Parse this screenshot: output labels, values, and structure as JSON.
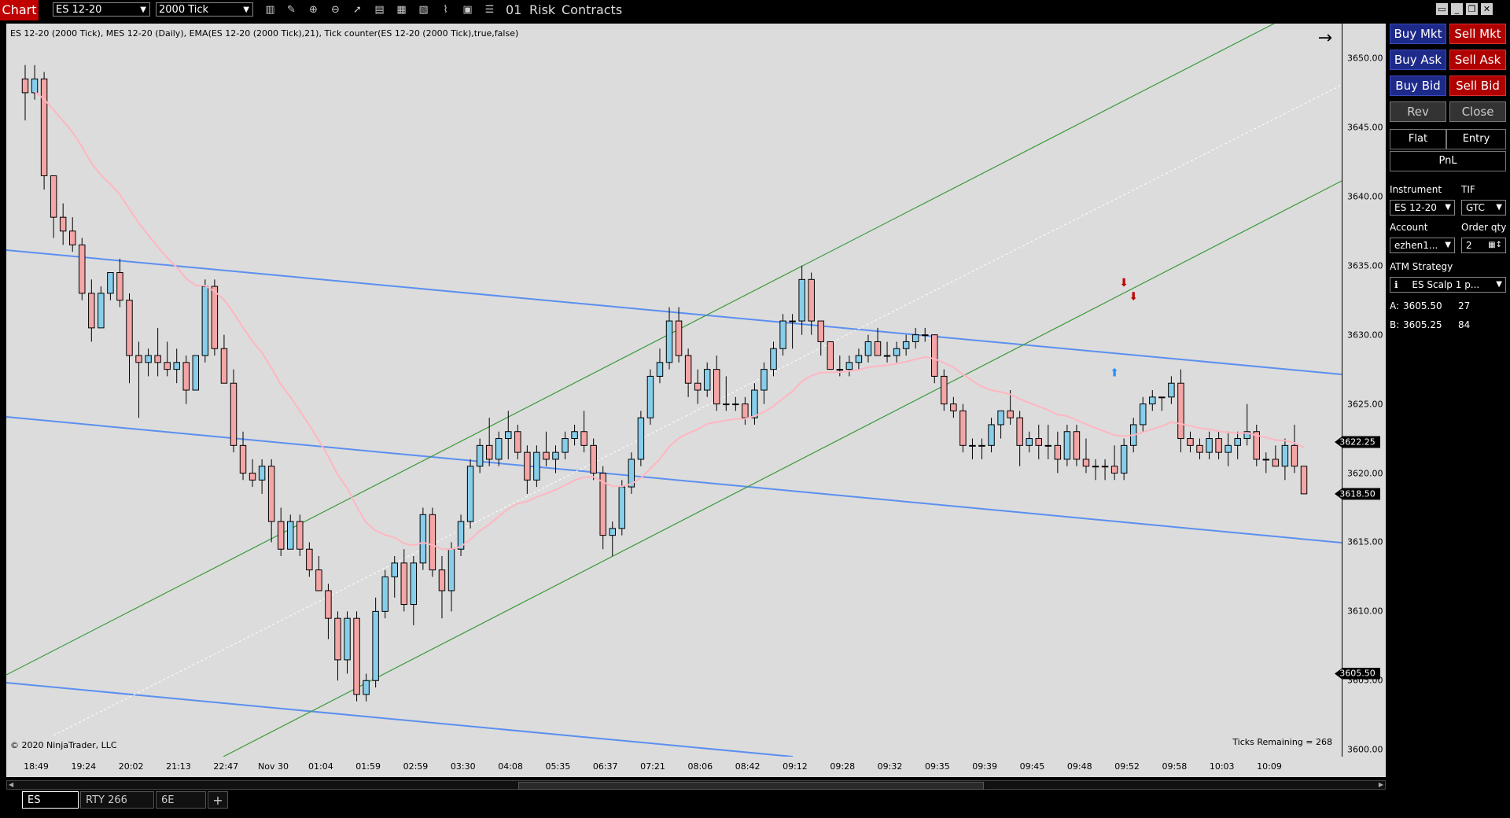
{
  "toolbar": {
    "chart_tab": "Chart",
    "instrument": "ES 12-20",
    "interval": "2000 Tick",
    "risk_label": "Risk",
    "count_label": "01",
    "contracts_label": "Contracts"
  },
  "chart": {
    "title": "ES 12-20 (2000 Tick), MES 12-20 (Daily), EMA(ES 12-20 (2000 Tick),21), Tick counter(ES 12-20 (2000 Tick),true,false)",
    "copyright": "© 2020 NinjaTrader, LLC",
    "ticks_remaining": "Ticks Remaining = 268",
    "nav_arrow": "→"
  },
  "chart_data": {
    "type": "candlestick",
    "y_ticks": [
      "3650.00",
      "3645.00",
      "3640.00",
      "3635.00",
      "3630.00",
      "3625.00",
      "3620.00",
      "3615.00",
      "3610.00",
      "3605.00",
      "3600.00"
    ],
    "x_ticks": [
      "18:49",
      "19:24",
      "20:02",
      "21:13",
      "22:47",
      "Nov 30",
      "01:04",
      "01:59",
      "02:59",
      "03:30",
      "04:08",
      "05:35",
      "06:37",
      "07:21",
      "08:06",
      "08:42",
      "09:12",
      "09:28",
      "09:32",
      "09:35",
      "09:39",
      "09:45",
      "09:48",
      "09:52",
      "09:58",
      "10:03",
      "10:09"
    ],
    "price_tags": [
      {
        "label": "3622.25",
        "value": 3622.25
      },
      {
        "label": "3618.50",
        "value": 3618.5
      },
      {
        "label": "3605.50",
        "value": 3605.5
      }
    ],
    "ylim": [
      3599.5,
      3652.5
    ],
    "candles": [
      [
        3648.5,
        3649.5,
        3645.5,
        3647.5
      ],
      [
        3647.5,
        3649.5,
        3647.0,
        3648.5
      ],
      [
        3648.5,
        3649.0,
        3640.5,
        3641.5
      ],
      [
        3641.5,
        3641.5,
        3637.0,
        3638.5
      ],
      [
        3638.5,
        3639.5,
        3636.5,
        3637.5
      ],
      [
        3637.5,
        3638.5,
        3636.0,
        3636.5
      ],
      [
        3636.5,
        3637.0,
        3632.5,
        3633.0
      ],
      [
        3633.0,
        3634.0,
        3629.5,
        3630.5
      ],
      [
        3630.5,
        3633.5,
        3630.5,
        3633.0
      ],
      [
        3633.0,
        3634.5,
        3632.5,
        3634.5
      ],
      [
        3634.5,
        3635.5,
        3632.0,
        3632.5
      ],
      [
        3632.5,
        3633.0,
        3626.5,
        3628.5
      ],
      [
        3628.5,
        3629.5,
        3624.0,
        3628.0
      ],
      [
        3628.0,
        3629.0,
        3627.0,
        3628.5
      ],
      [
        3628.5,
        3630.5,
        3627.0,
        3628.0
      ],
      [
        3628.0,
        3629.5,
        3627.0,
        3627.5
      ],
      [
        3627.5,
        3629.0,
        3626.5,
        3628.0
      ],
      [
        3628.0,
        3628.5,
        3625.0,
        3626.0
      ],
      [
        3626.0,
        3628.5,
        3626.0,
        3628.5
      ],
      [
        3628.5,
        3634.0,
        3628.0,
        3633.5
      ],
      [
        3633.5,
        3634.0,
        3628.5,
        3629.0
      ],
      [
        3629.0,
        3630.0,
        3626.5,
        3626.5
      ],
      [
        3626.5,
        3627.5,
        3621.5,
        3622.0
      ],
      [
        3622.0,
        3623.0,
        3619.5,
        3620.0
      ],
      [
        3620.0,
        3621.0,
        3619.0,
        3619.5
      ],
      [
        3619.5,
        3621.0,
        3618.5,
        3620.5
      ],
      [
        3620.5,
        3621.0,
        3615.0,
        3616.5
      ],
      [
        3616.5,
        3617.5,
        3614.0,
        3614.5
      ],
      [
        3614.5,
        3617.0,
        3614.5,
        3616.5
      ],
      [
        3616.5,
        3617.0,
        3614.0,
        3614.5
      ],
      [
        3614.5,
        3615.0,
        3612.5,
        3613.0
      ],
      [
        3613.0,
        3614.0,
        3611.5,
        3611.5
      ],
      [
        3611.5,
        3612.0,
        3608.0,
        3609.5
      ],
      [
        3609.5,
        3610.0,
        3605.0,
        3606.5
      ],
      [
        3606.5,
        3610.0,
        3605.5,
        3609.5
      ],
      [
        3609.5,
        3610.0,
        3603.5,
        3604.0
      ],
      [
        3604.0,
        3605.5,
        3603.5,
        3605.0
      ],
      [
        3605.0,
        3611.0,
        3604.5,
        3610.0
      ],
      [
        3610.0,
        3613.0,
        3609.5,
        3612.5
      ],
      [
        3612.5,
        3614.0,
        3611.0,
        3613.5
      ],
      [
        3613.5,
        3614.5,
        3610.0,
        3610.5
      ],
      [
        3610.5,
        3614.0,
        3609.0,
        3613.5
      ],
      [
        3613.5,
        3617.5,
        3613.0,
        3617.0
      ],
      [
        3617.0,
        3617.5,
        3612.5,
        3613.0
      ],
      [
        3613.0,
        3614.0,
        3609.5,
        3611.5
      ],
      [
        3611.5,
        3615.0,
        3610.0,
        3614.5
      ],
      [
        3614.5,
        3617.0,
        3614.0,
        3616.5
      ],
      [
        3616.5,
        3621.0,
        3616.0,
        3620.5
      ],
      [
        3620.5,
        3622.5,
        3620.0,
        3622.0
      ],
      [
        3622.0,
        3624.0,
        3620.5,
        3621.0
      ],
      [
        3621.0,
        3623.0,
        3620.5,
        3622.5
      ],
      [
        3622.5,
        3624.5,
        3621.0,
        3623.0
      ],
      [
        3623.0,
        3623.5,
        3621.0,
        3621.5
      ],
      [
        3621.5,
        3622.0,
        3618.5,
        3619.5
      ],
      [
        3619.5,
        3622.0,
        3619.0,
        3621.5
      ],
      [
        3621.5,
        3623.0,
        3620.5,
        3621.0
      ],
      [
        3621.0,
        3622.0,
        3620.0,
        3621.5
      ],
      [
        3621.5,
        3623.0,
        3621.0,
        3622.5
      ],
      [
        3622.5,
        3623.5,
        3622.0,
        3623.0
      ],
      [
        3623.0,
        3624.5,
        3621.5,
        3622.0
      ],
      [
        3622.0,
        3622.5,
        3619.5,
        3620.0
      ],
      [
        3620.0,
        3620.5,
        3614.5,
        3615.5
      ],
      [
        3615.5,
        3616.5,
        3614.0,
        3616.0
      ],
      [
        3616.0,
        3619.5,
        3615.5,
        3619.0
      ],
      [
        3619.0,
        3621.5,
        3618.5,
        3621.0
      ],
      [
        3621.0,
        3624.5,
        3620.5,
        3624.0
      ],
      [
        3624.0,
        3627.5,
        3623.5,
        3627.0
      ],
      [
        3627.0,
        3629.0,
        3626.5,
        3628.0
      ],
      [
        3628.0,
        3632.0,
        3627.5,
        3631.0
      ],
      [
        3631.0,
        3632.0,
        3628.0,
        3628.5
      ],
      [
        3628.5,
        3629.0,
        3625.5,
        3626.5
      ],
      [
        3626.5,
        3627.5,
        3625.0,
        3626.0
      ],
      [
        3626.0,
        3628.0,
        3625.5,
        3627.5
      ],
      [
        3627.5,
        3628.5,
        3624.5,
        3625.0
      ],
      [
        3625.0,
        3627.0,
        3624.5,
        3625.0
      ],
      [
        3625.0,
        3625.5,
        3624.5,
        3625.0
      ],
      [
        3625.0,
        3625.5,
        3623.5,
        3624.0
      ],
      [
        3624.0,
        3626.5,
        3623.5,
        3626.0
      ],
      [
        3626.0,
        3628.0,
        3625.0,
        3627.5
      ],
      [
        3627.5,
        3629.5,
        3627.0,
        3629.0
      ],
      [
        3629.0,
        3631.5,
        3628.5,
        3631.0
      ],
      [
        3631.0,
        3631.5,
        3629.0,
        3631.0
      ],
      [
        3631.0,
        3635.0,
        3630.0,
        3634.0
      ],
      [
        3634.0,
        3634.5,
        3630.0,
        3631.0
      ],
      [
        3631.0,
        3631.0,
        3628.5,
        3629.5
      ],
      [
        3629.5,
        3629.5,
        3627.5,
        3627.5
      ],
      [
        3627.5,
        3628.5,
        3627.0,
        3627.5
      ],
      [
        3627.5,
        3628.5,
        3627.0,
        3628.0
      ],
      [
        3628.0,
        3629.0,
        3627.5,
        3628.5
      ],
      [
        3628.5,
        3630.0,
        3628.0,
        3629.5
      ],
      [
        3629.5,
        3630.5,
        3628.5,
        3628.5
      ],
      [
        3628.5,
        3629.5,
        3628.0,
        3628.5
      ],
      [
        3628.5,
        3629.5,
        3628.0,
        3629.0
      ],
      [
        3629.0,
        3630.0,
        3628.5,
        3629.5
      ],
      [
        3629.5,
        3630.5,
        3629.0,
        3630.0
      ],
      [
        3630.0,
        3630.5,
        3629.5,
        3630.0
      ],
      [
        3630.0,
        3630.0,
        3626.5,
        3627.0
      ],
      [
        3627.0,
        3627.5,
        3624.5,
        3625.0
      ],
      [
        3625.0,
        3625.5,
        3624.0,
        3624.5
      ],
      [
        3624.5,
        3625.0,
        3621.5,
        3622.0
      ],
      [
        3622.0,
        3622.5,
        3621.0,
        3622.0
      ],
      [
        3622.0,
        3622.5,
        3621.0,
        3622.0
      ],
      [
        3622.0,
        3624.0,
        3621.5,
        3623.5
      ],
      [
        3623.5,
        3624.5,
        3622.5,
        3624.5
      ],
      [
        3624.5,
        3626.0,
        3623.5,
        3624.0
      ],
      [
        3624.0,
        3624.5,
        3620.5,
        3622.0
      ],
      [
        3622.0,
        3623.0,
        3621.5,
        3622.5
      ],
      [
        3622.5,
        3623.5,
        3621.0,
        3622.0
      ],
      [
        3622.0,
        3623.5,
        3621.0,
        3622.0
      ],
      [
        3622.0,
        3623.0,
        3620.0,
        3621.0
      ],
      [
        3621.0,
        3623.5,
        3620.5,
        3623.0
      ],
      [
        3623.0,
        3623.5,
        3620.5,
        3621.0
      ],
      [
        3621.0,
        3622.5,
        3620.0,
        3620.5
      ],
      [
        3620.5,
        3621.0,
        3619.5,
        3620.5
      ],
      [
        3620.5,
        3621.0,
        3619.5,
        3620.5
      ],
      [
        3620.5,
        3622.0,
        3619.5,
        3620.0
      ],
      [
        3620.0,
        3622.5,
        3619.5,
        3622.0
      ],
      [
        3622.0,
        3624.0,
        3621.5,
        3623.5
      ],
      [
        3623.5,
        3625.5,
        3623.0,
        3625.0
      ],
      [
        3625.0,
        3626.0,
        3624.5,
        3625.5
      ],
      [
        3625.5,
        3625.5,
        3624.5,
        3625.5
      ],
      [
        3625.5,
        3627.0,
        3625.0,
        3626.5
      ],
      [
        3626.5,
        3627.5,
        3621.5,
        3622.5
      ],
      [
        3622.5,
        3623.0,
        3621.5,
        3622.0
      ],
      [
        3622.0,
        3622.5,
        3621.0,
        3621.5
      ],
      [
        3621.5,
        3623.0,
        3621.0,
        3622.5
      ],
      [
        3622.5,
        3623.0,
        3621.0,
        3621.5
      ],
      [
        3621.5,
        3623.0,
        3620.5,
        3622.0
      ],
      [
        3622.0,
        3623.0,
        3621.0,
        3622.5
      ],
      [
        3622.5,
        3625.0,
        3622.0,
        3623.0
      ],
      [
        3623.0,
        3623.5,
        3620.5,
        3621.0
      ],
      [
        3621.0,
        3621.5,
        3620.0,
        3621.0
      ],
      [
        3621.0,
        3622.0,
        3620.5,
        3620.5
      ],
      [
        3620.5,
        3622.5,
        3619.5,
        3622.0
      ],
      [
        3622.0,
        3623.5,
        3620.0,
        3620.5
      ],
      [
        3620.5,
        3620.5,
        3618.5,
        3618.5
      ]
    ]
  },
  "trade_panel": {
    "buy_mkt": "Buy Mkt",
    "sell_mkt": "Sell Mkt",
    "buy_ask": "Buy Ask",
    "sell_ask": "Sell Ask",
    "buy_bid": "Buy Bid",
    "sell_bid": "Sell Bid",
    "rev": "Rev",
    "close": "Close",
    "flat": "Flat",
    "entry": "Entry",
    "pnl": "PnL",
    "instrument_label": "Instrument",
    "tif_label": "TIF",
    "instrument_value": "ES 12-20",
    "tif_value": "GTC",
    "account_label": "Account",
    "order_qty_label": "Order qty",
    "account_value": "ezhen1...",
    "order_qty_value": "2",
    "atm_label": "ATM Strategy",
    "atm_value": "ES Scalp 1 p...",
    "atm_info": "ℹ",
    "ask_label": "A:",
    "ask_price": "3605.50",
    "ask_size": "27",
    "bid_label": "B:",
    "bid_price": "3605.25",
    "bid_size": "84"
  },
  "tabs": [
    "ES",
    "RTY 266",
    "6E",
    "+"
  ],
  "colors": {
    "up": "#87ceeb",
    "down": "#f4a6a6",
    "ema": "#ffb6c1",
    "blue_channel": "#5b8ff0",
    "green_channel": "#3c9a3c",
    "signal": "#c00000",
    "signal_up": "#1e90ff"
  }
}
